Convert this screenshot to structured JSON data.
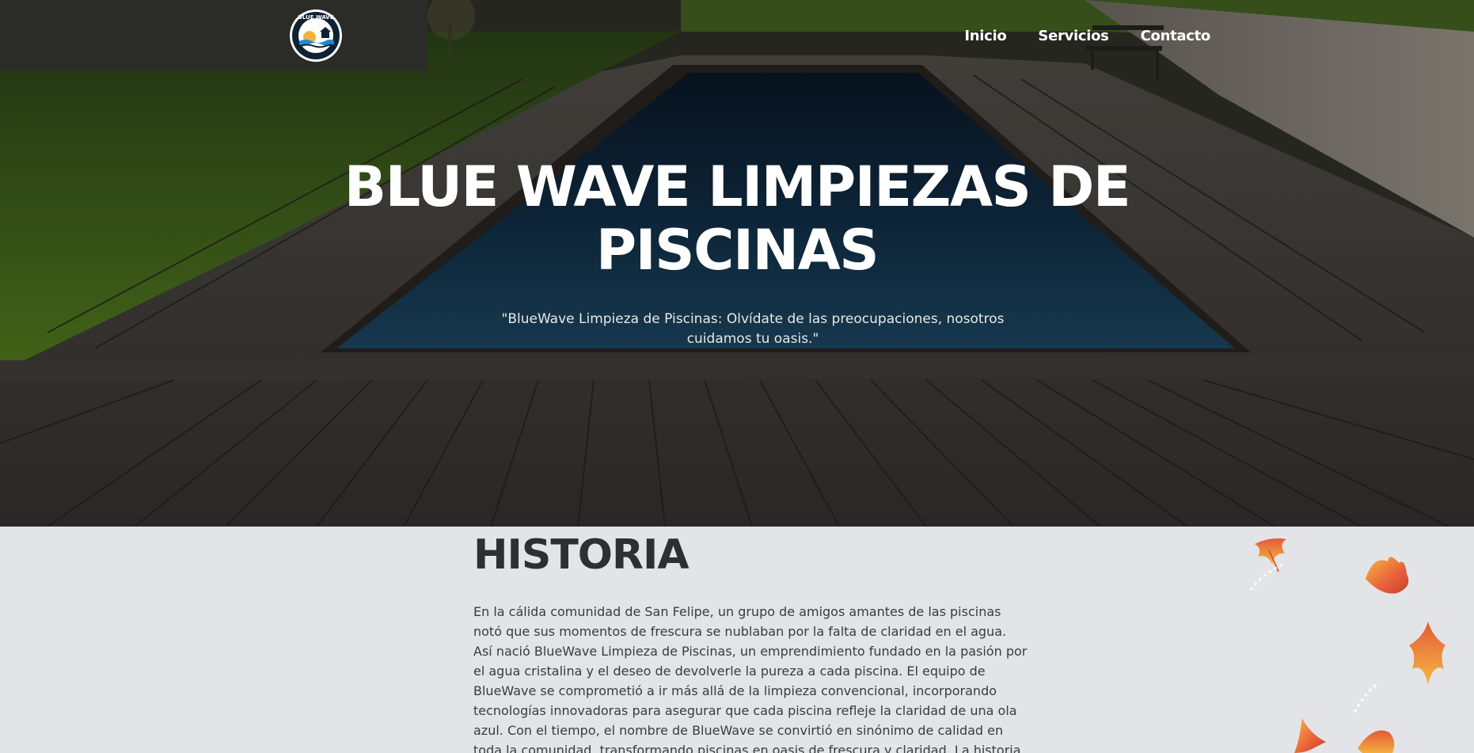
{
  "header": {
    "logo": {
      "text": "BLUE WAVE",
      "icon": "blue-wave-logo"
    },
    "nav": [
      {
        "label": "Inicio"
      },
      {
        "label": "Servicios"
      },
      {
        "label": "Contacto"
      }
    ]
  },
  "hero": {
    "title": "BLUE WAVE LIMPIEZAS DE PISCINAS",
    "subtitle": "\"BlueWave Limpieza de Piscinas: Olvídate de las preocupaciones, nosotros cuidamos tu oasis.\""
  },
  "historia": {
    "title": "HISTORIA",
    "text": "En la cálida comunidad de San Felipe, un grupo de amigos amantes de las piscinas notó que sus momentos de frescura se nublaban por la falta de claridad en el agua. Así nació BlueWave Limpieza de Piscinas, un emprendimiento fundado en la pasión por el agua cristalina y el deseo de devolverle la pureza a cada piscina. El equipo de BlueWave se comprometió a ir más allá de la limpieza convencional, incorporando tecnologías innovadoras para asegurar que cada piscina refleje la claridad de una ola azul. Con el tiempo, el nombre de BlueWave se convirtió en sinónimo de calidad en toda la comunidad, transformando piscinas en oasis de frescura y claridad. La historia"
  },
  "decor": {
    "icons": [
      "autumn-leaf-icon"
    ]
  },
  "colors": {
    "hero_text": "#ffffff",
    "section_bg": "#e3e4e7",
    "heading": "#2e2f33",
    "leaf_orange": "#e8603c",
    "leaf_yellow": "#f3b23c"
  }
}
